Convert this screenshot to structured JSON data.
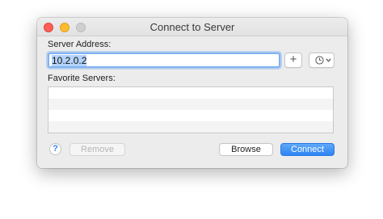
{
  "window": {
    "title": "Connect to Server"
  },
  "form": {
    "server_address_label": "Server Address:",
    "server_address_value": "10.2.0.2",
    "favorites_label": "Favorite Servers:"
  },
  "buttons": {
    "add": "+",
    "help": "?",
    "remove": "Remove",
    "browse": "Browse",
    "connect": "Connect"
  },
  "icons": {
    "recent": "clock-icon",
    "dropdown": "chevron-down-icon"
  },
  "colors": {
    "accent": "#2e84f3",
    "focus_ring": "#7fb1f2",
    "close": "#fd5f57",
    "minimize": "#febc2e",
    "zoom_disabled": "#cfcfcf"
  }
}
